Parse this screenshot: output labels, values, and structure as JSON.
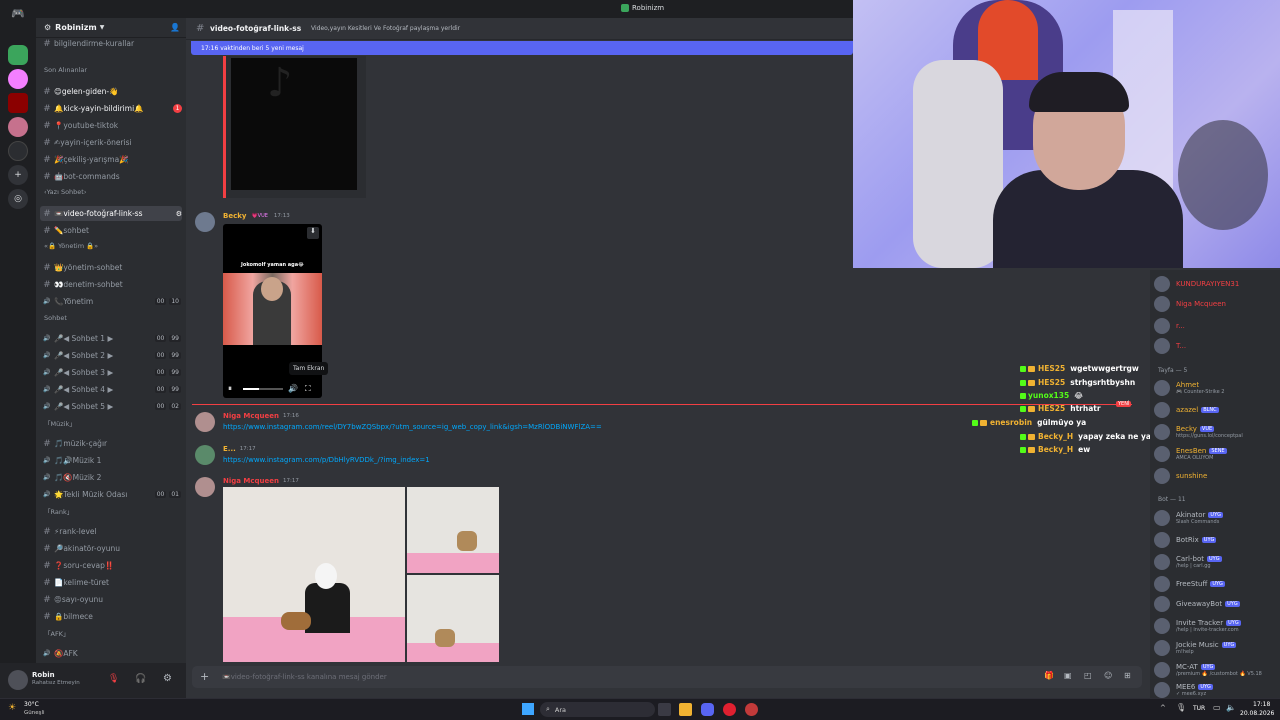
{
  "window": {
    "title": "Robinizm"
  },
  "server": {
    "name": "Robinizm"
  },
  "sidebar": {
    "top_item": "bilgilendirme-kurallar",
    "categories": {
      "recent": "Son Alınanlar",
      "yazi": "‹Yazı Sohbet›",
      "yonetim": "«🔒 Yönetim 🔒»",
      "sohbet": "Sohbet",
      "muzik": "「Müzik」",
      "rank": "「Rank」",
      "afk": "「AFK」"
    },
    "channels": [
      {
        "label": "😊gelen-giden-👋",
        "bold": true
      },
      {
        "label": "🔔kick-yayin-bildirimi🔔",
        "bold": true,
        "badge": "1"
      },
      {
        "label": "📍youtube-tiktok"
      },
      {
        "label": "✍yayin-içerik-önerisi"
      },
      {
        "label": "🎉çekiliş-yarışma🎉"
      },
      {
        "label": "🤖bot-commands"
      },
      {
        "label": "📼video-fotoğraf-link-ss",
        "selected": true
      },
      {
        "label": "✏️sohbet"
      },
      {
        "label": "👑yönetim-sohbet"
      },
      {
        "label": "👀denetim-sohbet"
      },
      {
        "label": "📞Yönetim",
        "voice": true,
        "counts": [
          "00",
          "10"
        ]
      },
      {
        "label": "🎤◀ Sohbet 1 ▶",
        "voice": true,
        "counts": [
          "00",
          "99"
        ]
      },
      {
        "label": "🎤◀ Sohbet 2 ▶",
        "voice": true,
        "counts": [
          "00",
          "99"
        ]
      },
      {
        "label": "🎤◀ Sohbet 3 ▶",
        "voice": true,
        "counts": [
          "00",
          "99"
        ]
      },
      {
        "label": "🎤◀ Sohbet 4 ▶",
        "voice": true,
        "counts": [
          "00",
          "99"
        ]
      },
      {
        "label": "🎤◀ Sohbet 5 ▶",
        "voice": true,
        "counts": [
          "00",
          "02"
        ]
      },
      {
        "label": "🎵müzik-çağır"
      },
      {
        "label": "🎵🔊Müzik 1",
        "voice": true
      },
      {
        "label": "🎵🔇Müzik 2",
        "voice": true
      },
      {
        "label": "🌟Tekli Müzik Odası",
        "voice": true,
        "counts": [
          "00",
          "01"
        ]
      },
      {
        "label": "⚡rank-level"
      },
      {
        "label": "🔎akinatör-oyunu"
      },
      {
        "label": "❓soru-cevap‼️"
      },
      {
        "label": "📄kelime-türet"
      },
      {
        "label": "😡sayı-oyunu"
      },
      {
        "label": "🔒bilmece"
      },
      {
        "label": "🔕AFK",
        "voice": true
      }
    ]
  },
  "user": {
    "name": "Robin",
    "status": "Rahatsız Etmeyin"
  },
  "header": {
    "channel": "video-fotoğraf-link-ss",
    "topic": "Video,yayın Kesitleri Ve Fotoğraf paylaşma yerldir"
  },
  "newbar": {
    "text": "17:16 vaktinden beri 5 yeni mesaj"
  },
  "messages": [
    {
      "name": "Becky",
      "tag": "💗VUE",
      "time": "17:13",
      "video_caption": "Jokomolf yaman aga😂",
      "tooltip": "Tam Ekran"
    },
    {
      "name": "Niga Mcqueen",
      "time": "17:16",
      "link": "https://www.instagram.com/reel/DY7bwZQSbpx/?utm_source=ig_web_copy_link&igsh=MzRlODBiNWFlZA=="
    },
    {
      "name": "E...",
      "time": "17:17",
      "link": "https://www.instagram.com/p/DbHlyRVDDk_/?img_index=1"
    },
    {
      "name": "Niga Mcqueen",
      "time": "17:17"
    }
  ],
  "new_label": "YENİ",
  "chat_overlay": [
    {
      "user": "HES25",
      "text": "wgetwwgertrgw",
      "color": "#f0b232"
    },
    {
      "user": "HES25",
      "text": "strhgsrhtbyshn",
      "color": "#f0b232"
    },
    {
      "user": "yunox135",
      "text": "😂",
      "color": "#53fc18"
    },
    {
      "user": "HES25",
      "text": "htrhatr",
      "color": "#f0b232"
    },
    {
      "user": "enesrobin",
      "text": "gülmüyo ya",
      "color": "#f0b232"
    },
    {
      "user": "Becky_H",
      "text": "yapay zeka ne ya",
      "color": "#f0b232"
    },
    {
      "user": "Becky_H",
      "text": "ew",
      "color": "#f0b232"
    }
  ],
  "members": {
    "top": [
      {
        "name": "KUNDURAYIYEN31",
        "color": "#f23f43"
      },
      {
        "name": "Niga Mcqueen",
        "color": "#f23f43"
      },
      {
        "name": "r...",
        "color": "#f23f43"
      },
      {
        "name": "T...",
        "color": "#f23f43"
      }
    ],
    "cat_tayfa": "Tayfa — 5",
    "tayfa": [
      {
        "name": "Ahmet",
        "sub": "🎮 Counter-Strike 2",
        "color": "#f0b232"
      },
      {
        "name": "azazel",
        "tag": "BLNC",
        "color": "#f0b232"
      },
      {
        "name": "Becky",
        "tag": "VUE",
        "sub": "https://guns.lol/conceptpal",
        "color": "#f0b232"
      },
      {
        "name": "EnesBen",
        "tag": "SENE",
        "sub": "AMCA OLUYOM",
        "color": "#f0b232"
      },
      {
        "name": "sunshine",
        "color": "#f0b232"
      }
    ],
    "cat_bot": "Bot — 11",
    "bots": [
      {
        "name": "Akinator",
        "tag": "UYG",
        "sub": "Slash Commands"
      },
      {
        "name": "BotRix",
        "tag": "UYG"
      },
      {
        "name": "Carl-bot",
        "tag": "UYG",
        "sub": "/help | carl.gg"
      },
      {
        "name": "FreeStuff",
        "tag": "UYG"
      },
      {
        "name": "GiveawayBot",
        "tag": "UYG"
      },
      {
        "name": "Invite Tracker",
        "tag": "UYG",
        "sub": "/help | invite-tracker.com"
      },
      {
        "name": "Jockie Music",
        "tag": "UYG",
        "sub": "m!help"
      },
      {
        "name": "MC-AT",
        "tag": "UYG",
        "sub": "/premium 🔥 /custombot 🔥 V5.18"
      },
      {
        "name": "MEE6",
        "tag": "UYG",
        "sub": "✓ mee6.xyz"
      }
    ]
  },
  "input": {
    "placeholder": "📼video-fotoğraf-link-ss kanalına mesaj gönder"
  },
  "taskbar": {
    "weather_temp": "30°C",
    "weather_desc": "Güneşli",
    "search": "Ara",
    "lang": "TUR",
    "time": "17:18",
    "date": "20.08.2026"
  }
}
